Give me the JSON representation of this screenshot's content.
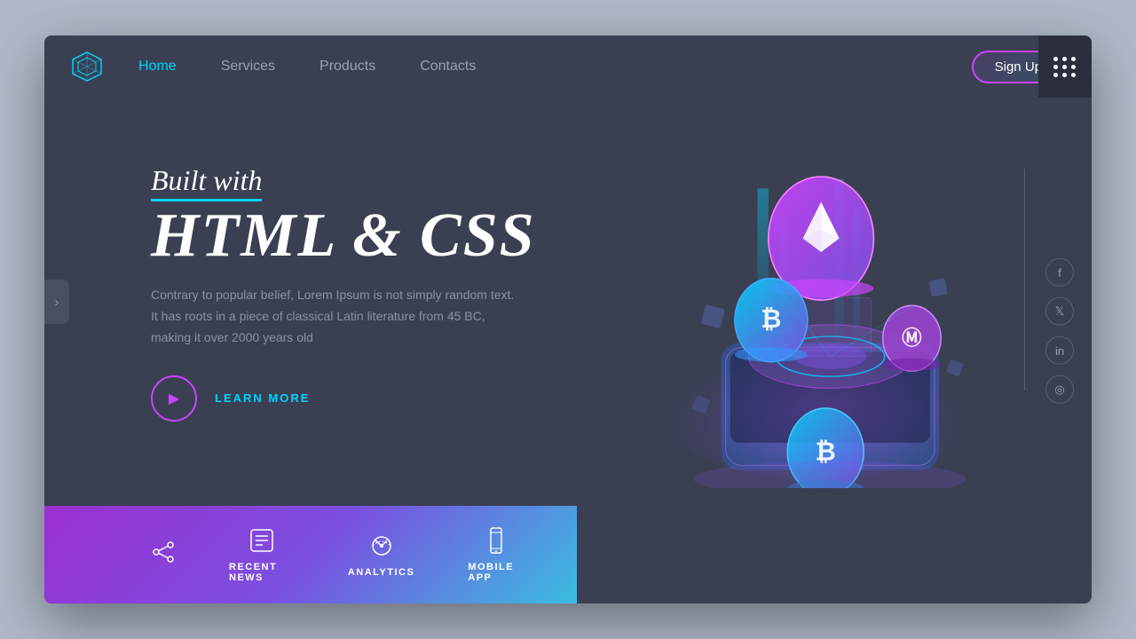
{
  "nav": {
    "links": [
      {
        "label": "Home",
        "active": true
      },
      {
        "label": "Services",
        "active": false
      },
      {
        "label": "Products",
        "active": false
      },
      {
        "label": "Contacts",
        "active": false
      }
    ],
    "signup_label": "Sign Up"
  },
  "hero": {
    "built_with": "Built with",
    "title": "HTML & CSS",
    "description": "Contrary to popular belief, Lorem Ipsum is not simply random text. It has roots in a piece of classical Latin literature from 45 BC, making it over 2000 years old",
    "cta_label": "LEARN MORE"
  },
  "bottom_bar": {
    "items": [
      {
        "label": "RECENT NEWS",
        "icon": "💬"
      },
      {
        "label": "ANALYTICS",
        "icon": "⚙"
      },
      {
        "label": "MOBILE APP",
        "icon": "📱"
      }
    ]
  },
  "social": {
    "items": [
      {
        "label": "facebook",
        "symbol": "f"
      },
      {
        "label": "twitter",
        "symbol": "t"
      },
      {
        "label": "linkedin",
        "symbol": "in"
      },
      {
        "label": "instagram",
        "symbol": "○"
      }
    ]
  },
  "colors": {
    "accent_cyan": "#00d4ff",
    "accent_purple": "#cc44ff",
    "bg_dark": "#3a3f52",
    "text_muted": "#8892a4"
  }
}
